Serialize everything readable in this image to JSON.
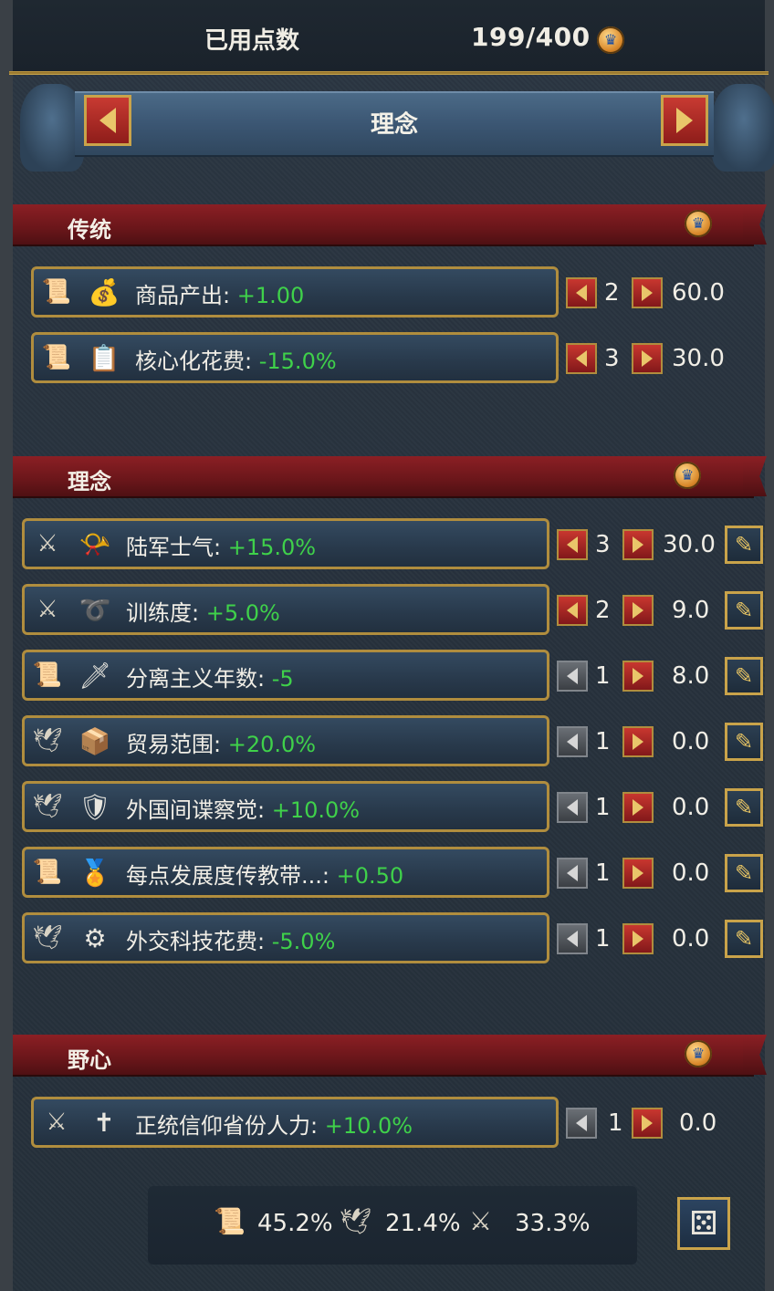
{
  "header": {
    "title": "已用点数",
    "value": "199/400",
    "crown_icon": "crown-coin-icon"
  },
  "banner": {
    "title": "理念"
  },
  "sections": {
    "tradition": {
      "name": "传统",
      "rows": [
        {
          "category_icon": "admin-scroll-icon",
          "item_icon": "trade-goods-icon",
          "label": "商品产出:",
          "value": "+1.00",
          "level": "2",
          "cost": "60.0"
        },
        {
          "category_icon": "admin-scroll-icon",
          "item_icon": "core-cost-icon",
          "label": "核心化花费:",
          "value": "-15.0%",
          "level": "3",
          "cost": "30.0"
        }
      ]
    },
    "ideas": {
      "name": "理念",
      "rows": [
        {
          "category_icon": "military-swords-icon",
          "item_icon": "trumpet-icon",
          "label": "陆军士气:",
          "value": "+15.0%",
          "level": "3",
          "cost": "30.0"
        },
        {
          "category_icon": "military-swords-icon",
          "item_icon": "whip-icon",
          "label": "训练度:",
          "value": "+5.0%",
          "level": "2",
          "cost": "9.0"
        },
        {
          "category_icon": "admin-scroll-icon",
          "item_icon": "separatism-icon",
          "label": "分离主义年数:",
          "value": "-5",
          "level": "1",
          "cost": "8.0"
        },
        {
          "category_icon": "diplo-dove-icon",
          "item_icon": "trade-range-icon",
          "label": "贸易范围:",
          "value": "+20.0%",
          "level": "1",
          "cost": "0.0"
        },
        {
          "category_icon": "diplo-dove-icon",
          "item_icon": "spy-icon",
          "label": "外国间谍察觉:",
          "value": "+10.0%",
          "level": "1",
          "cost": "0.0"
        },
        {
          "category_icon": "admin-scroll-icon",
          "item_icon": "missionary-icon",
          "label": "每点发展度传教带...:",
          "value": "+0.50",
          "level": "1",
          "cost": "0.0"
        },
        {
          "category_icon": "diplo-dove-icon",
          "item_icon": "diplo-tech-icon",
          "label": "外交科技花费:",
          "value": "-5.0%",
          "level": "1",
          "cost": "0.0"
        }
      ]
    },
    "ambition": {
      "name": "野心",
      "rows": [
        {
          "category_icon": "military-swords-icon",
          "item_icon": "faith-manpower-icon",
          "label": "正统信仰省份人力:",
          "value": "+10.0%",
          "level": "1",
          "cost": "0.0"
        }
      ]
    }
  },
  "footer": {
    "admin_pct": "45.2%",
    "diplo_pct": "21.4%",
    "mil_pct": "33.3%"
  },
  "colors": {
    "positive": "#3fd14a",
    "gold_border": "#b08d3e",
    "section_red": "#8b1f24"
  }
}
